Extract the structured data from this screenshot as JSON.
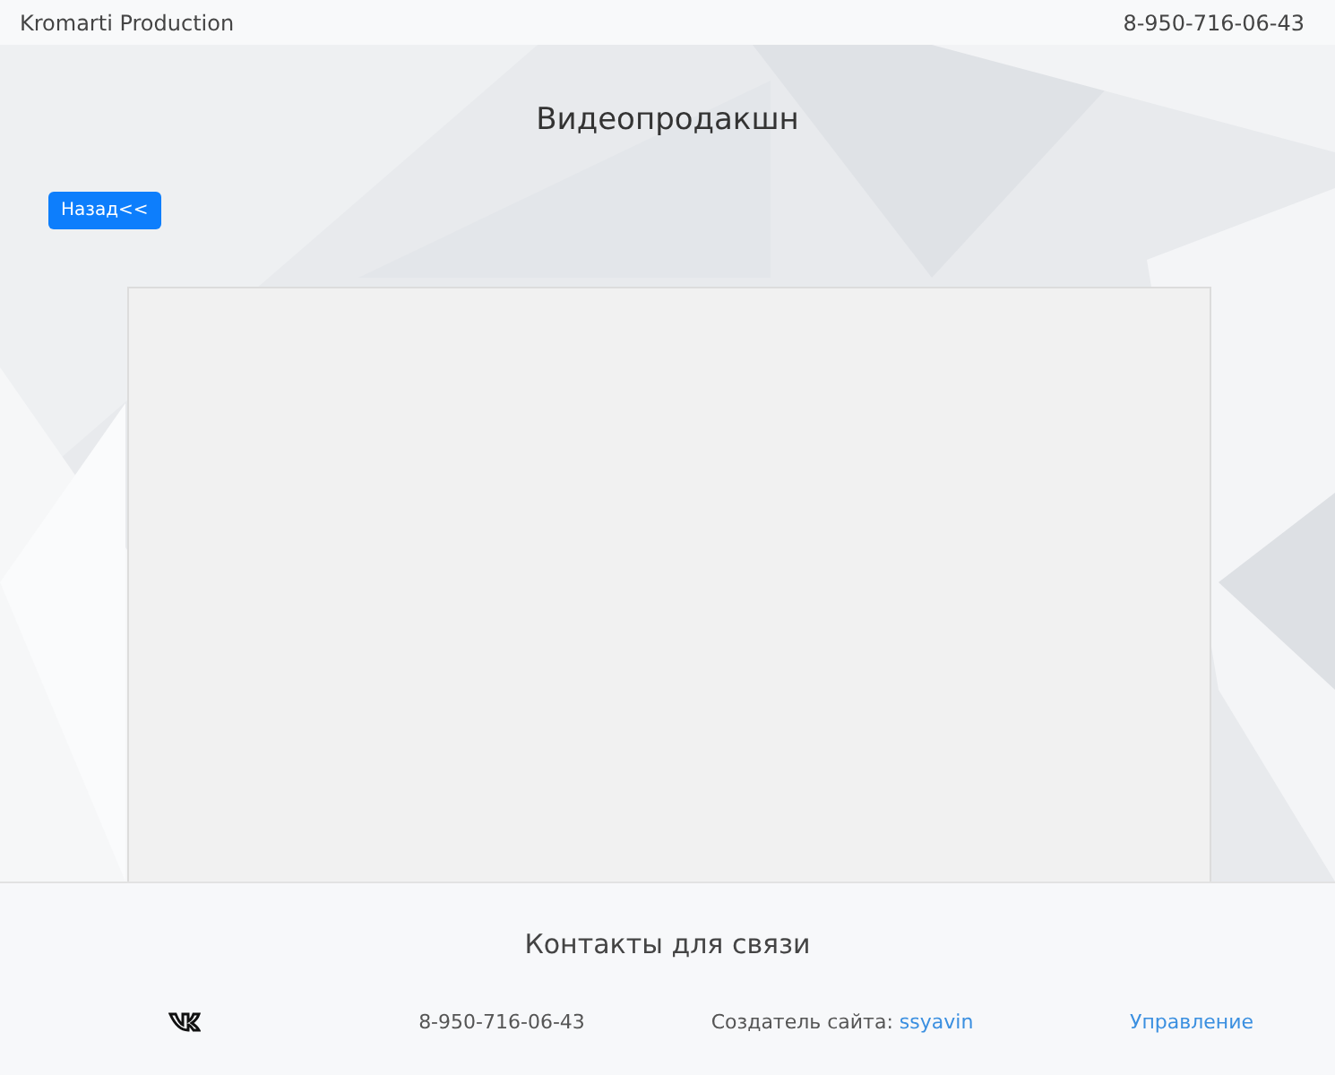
{
  "header": {
    "brand": "Kromarti Production",
    "phone": "8-950-716-06-43"
  },
  "main": {
    "title": "Видеопродакшн",
    "back_button": "Назад<<"
  },
  "footer": {
    "title": "Контакты для связи",
    "phone": "8-950-716-06-43",
    "creator": {
      "label": "Создатель сайта:",
      "link": "ssyavin"
    },
    "admin_link": "Управление"
  }
}
